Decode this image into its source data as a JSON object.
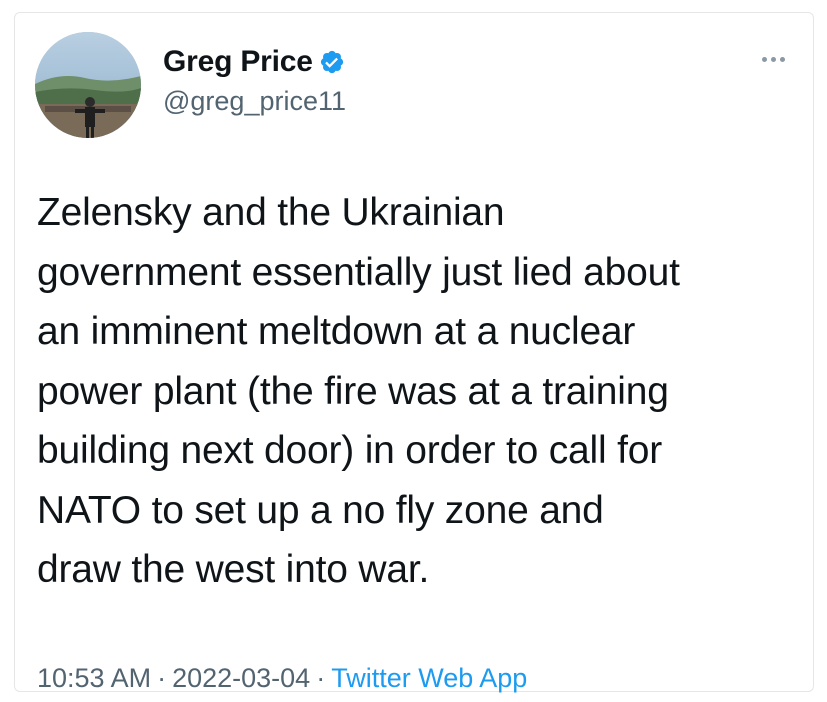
{
  "author": {
    "display_name": "Greg Price",
    "handle": "@greg_price11",
    "verified": true,
    "avatar_icon": "profile-photo-icon"
  },
  "tweet": {
    "lines": [
      "Zelensky and the Ukrainian",
      "government essentially just lied about",
      "an imminent meltdown at a nuclear",
      "power plant (the fire was at a training",
      "building next door) in order to call for",
      "NATO to set up a no fly zone and",
      "draw the west into war."
    ]
  },
  "meta": {
    "time": "10:53 AM",
    "separator": "·",
    "date": "2022-03-04",
    "source": "Twitter Web App"
  },
  "colors": {
    "verified_badge": "#1d9bf0",
    "link": "#1d9bf0",
    "secondary_text": "#536471"
  }
}
